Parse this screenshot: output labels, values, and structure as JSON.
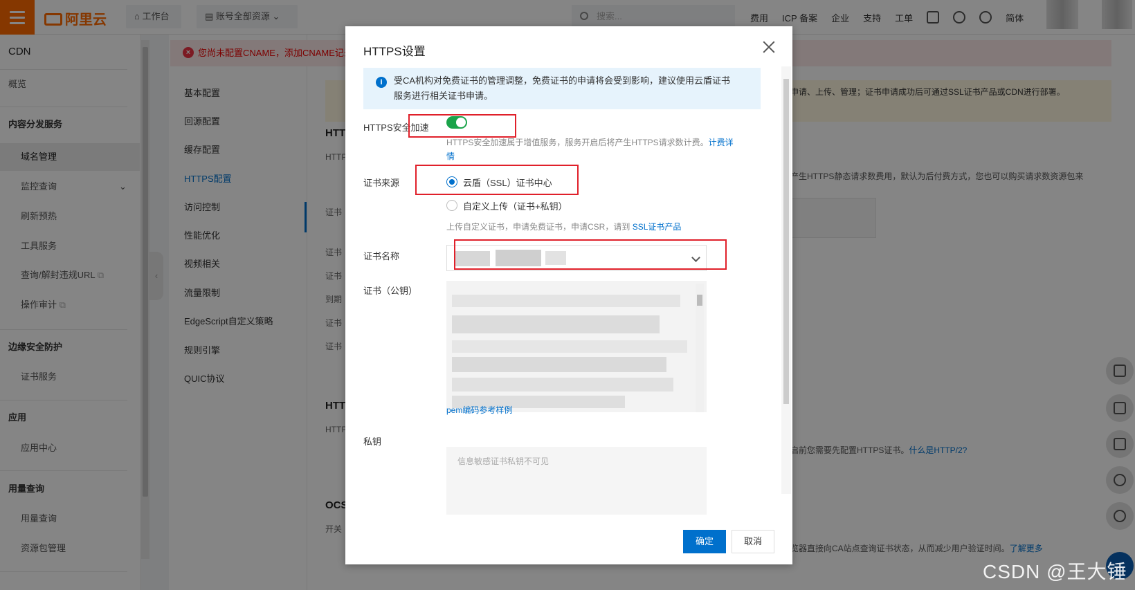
{
  "topbar": {
    "logo": "阿里云",
    "workbench": "工作台",
    "resource_scope": "账号全部资源",
    "search_placeholder": "搜索...",
    "links": [
      "费用",
      "ICP 备案",
      "企业",
      "支持",
      "工单"
    ],
    "lang": "简体"
  },
  "sidebar": {
    "title": "CDN",
    "overview": "概览",
    "groups": [
      {
        "label": "内容分发服务",
        "items": [
          "域名管理",
          "监控查询",
          "刷新预热",
          "工具服务",
          "查询/解封违规URL",
          "操作审计"
        ]
      },
      {
        "label": "边缘安全防护",
        "items": [
          "证书服务"
        ]
      },
      {
        "label": "应用",
        "items": [
          "应用中心"
        ]
      },
      {
        "label": "用量查询",
        "items": [
          "用量查询",
          "资源包管理"
        ]
      }
    ],
    "active_item": "域名管理"
  },
  "domain_menu": {
    "items": [
      "基本配置",
      "回源配置",
      "缓存配置",
      "HTTPS配置",
      "访问控制",
      "性能优化",
      "视频相关",
      "流量限制",
      "EdgeScript自定义策略",
      "规则引擎",
      "QUIC协议"
    ],
    "active_item": "HTTPS配置"
  },
  "background": {
    "error_banner": "您尚未配置CNAME，添加CNAME记录",
    "warning_fragment": "申请、上传、管理；证书申请成功后可通过SSL证书产品或CDN进行部署。",
    "headings": [
      "HTT",
      "HTT",
      "OCS"
    ],
    "labels": [
      "HTTP",
      "证书",
      "证书",
      "证书",
      "到期",
      "证书",
      "证书",
      "HTTP",
      "开关"
    ],
    "text1": "产生HTTPS静态请求数费用，默认为后付费方式，您也可以购买请求数资源包来",
    "text2": "启前您需要先配置HTTPS证书。",
    "link2": "什么是HTTP/2?",
    "text3": "览器直接向CA站点查询证书状态，从而减少用户验证时间。",
    "link3": "了解更多"
  },
  "modal": {
    "title": "HTTPS设置",
    "notice": "受CA机构对免费证书的管理调整，免费证书的申请将会受到影响，建议使用云盾证书服务进行相关证书申请。",
    "https_label": "HTTPS安全加速",
    "https_enabled": true,
    "https_help": "HTTPS安全加速属于增值服务，服务开启后将产生HTTPS请求数计费。",
    "https_help_link": "计费详情",
    "cert_source_label": "证书来源",
    "cert_source_options": [
      "云盾（SSL）证书中心",
      "自定义上传（证书+私钥）"
    ],
    "cert_source_selected": "云盾（SSL）证书中心",
    "cert_source_help": "上传自定义证书，申请免费证书，申请CSR，请到",
    "cert_source_help_link": "SSL证书产品",
    "cert_name_label": "证书名称",
    "cert_public_label": "证书（公钥）",
    "pem_link": "pem编码参考样例",
    "private_key_label": "私钥",
    "private_key_placeholder": "信息敏感证书私钥不可见",
    "ok_button": "确定",
    "cancel_button": "取消"
  },
  "watermark": "CSDN @王大锤"
}
